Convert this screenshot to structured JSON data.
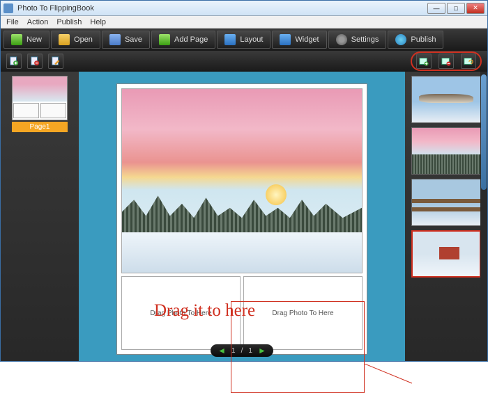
{
  "titlebar": {
    "title": "Photo To FlippingBook"
  },
  "menubar": {
    "items": [
      "File",
      "Action",
      "Publish",
      "Help"
    ]
  },
  "toolbar": {
    "new": "New",
    "open": "Open",
    "save": "Save",
    "add_page": "Add Page",
    "layout": "Layout",
    "widget": "Widget",
    "settings": "Settings",
    "publish": "Publish"
  },
  "left_panel": {
    "page_thumbs": [
      {
        "label": "Page1"
      }
    ]
  },
  "editor": {
    "slot2_placeholder": "Drag Photo To Here",
    "slot3_placeholder": "Drag Photo To Here"
  },
  "pager": {
    "current": "1",
    "sep": "/",
    "total": "1"
  },
  "annotation": {
    "text": "Drag it to here"
  },
  "right_panel": {
    "photos": [
      {
        "name": "winter-mountain-1",
        "theme": "a"
      },
      {
        "name": "winter-sunset",
        "theme": "b"
      },
      {
        "name": "winter-fence",
        "theme": "c"
      },
      {
        "name": "winter-barn",
        "theme": "d",
        "selected": true
      }
    ]
  },
  "colors": {
    "highlight": "#d03020",
    "canvas_bg": "#3a9bbf",
    "accent": "#f5a623"
  }
}
